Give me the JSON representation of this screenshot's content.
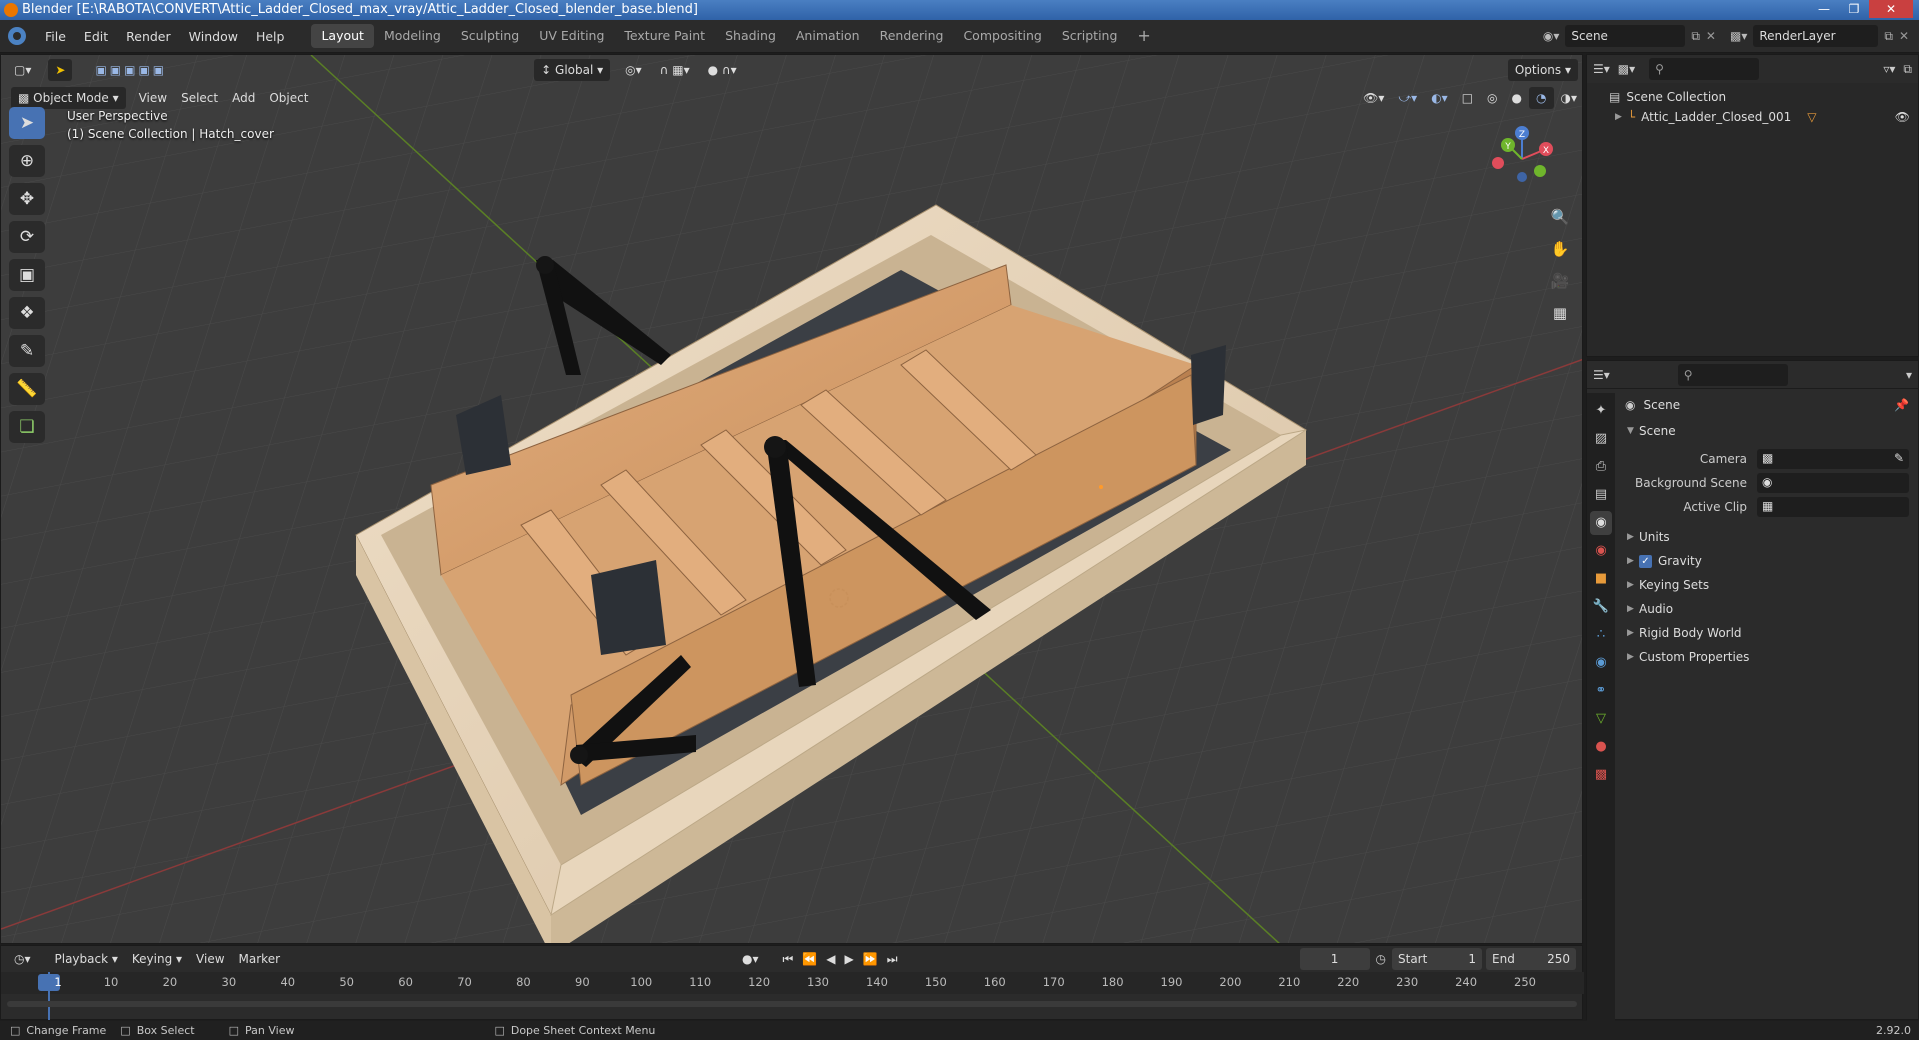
{
  "window": {
    "title": "Blender [E:\\RABOTA\\CONVERT\\Attic_Ladder_Closed_max_vray/Attic_Ladder_Closed_blender_base.blend]"
  },
  "menu": [
    "File",
    "Edit",
    "Render",
    "Window",
    "Help"
  ],
  "workspaces": [
    "Layout",
    "Modeling",
    "Sculpting",
    "UV Editing",
    "Texture Paint",
    "Shading",
    "Animation",
    "Rendering",
    "Compositing",
    "Scripting"
  ],
  "scene_field": "Scene",
  "renderlayer_field": "RenderLayer",
  "viewport": {
    "transform_orientation": "Global",
    "options_label": "Options",
    "mode": "Object Mode",
    "menus": [
      "View",
      "Select",
      "Add",
      "Object"
    ],
    "overlay_line1": "User Perspective",
    "overlay_line2": "(1) Scene Collection | Hatch_cover",
    "gizmo": {
      "x": "X",
      "y": "Y",
      "z": "Z"
    }
  },
  "outliner": {
    "root": "Scene Collection",
    "items": [
      {
        "name": "Attic_Ladder_Closed_001"
      }
    ]
  },
  "properties": {
    "header": "Scene",
    "section": "Scene",
    "fields": [
      {
        "label": "Camera"
      },
      {
        "label": "Background Scene"
      },
      {
        "label": "Active Clip"
      }
    ],
    "panels": [
      {
        "label": "Units",
        "checkbox": false
      },
      {
        "label": "Gravity",
        "checkbox": true,
        "checked": true
      },
      {
        "label": "Keying Sets",
        "checkbox": false
      },
      {
        "label": "Audio",
        "checkbox": false
      },
      {
        "label": "Rigid Body World",
        "checkbox": false
      },
      {
        "label": "Custom Properties",
        "checkbox": false
      }
    ]
  },
  "timeline": {
    "menus": [
      "Playback",
      "Keying",
      "View",
      "Marker"
    ],
    "current_frame": "1",
    "start_label": "Start",
    "start": "1",
    "end_label": "End",
    "end": "250",
    "ticks": [
      "1",
      "10",
      "20",
      "30",
      "40",
      "50",
      "60",
      "70",
      "80",
      "90",
      "100",
      "110",
      "120",
      "130",
      "140",
      "150",
      "160",
      "170",
      "180",
      "190",
      "200",
      "210",
      "220",
      "230",
      "240",
      "250"
    ]
  },
  "status": {
    "items": [
      "Change Frame",
      "Box Select",
      "Pan View",
      "Dope Sheet Context Menu"
    ],
    "version": "2.92.0"
  },
  "colors": {
    "accent": "#4772b3",
    "wood": "#d9a574",
    "frame_wood": "#e6d2b8"
  }
}
